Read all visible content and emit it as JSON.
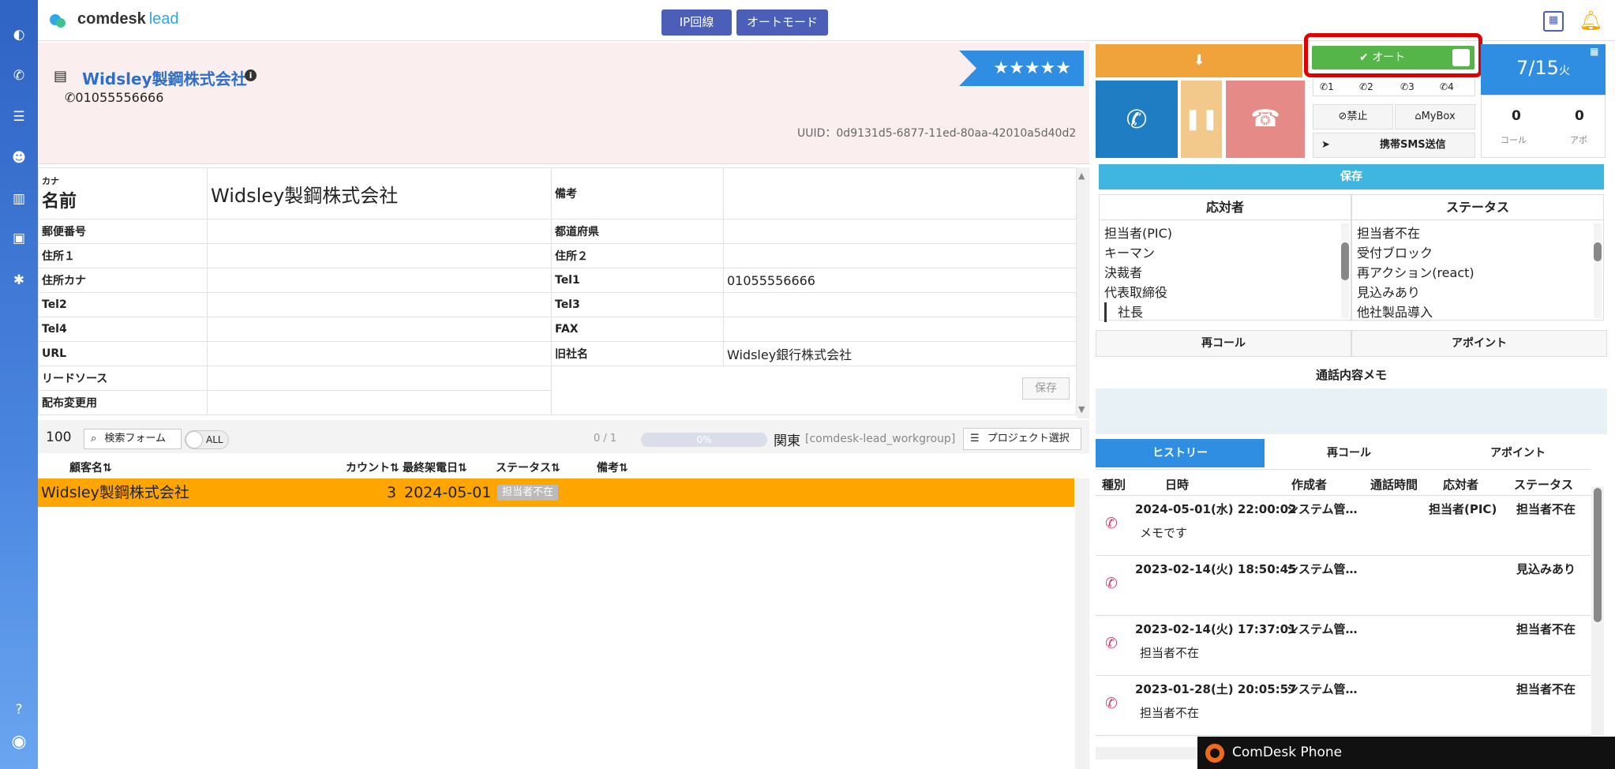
{
  "brand": {
    "name": "comdesk",
    "suffix": "lead"
  },
  "top_buttons": {
    "ip_line": "IP回線",
    "auto_mode": "オートモード"
  },
  "company": {
    "name": "Widsley製鋼株式会社",
    "phone": "01055556666",
    "uuid": "UUID：0d9131d5-6877-11ed-80aa-42010a5d40d2",
    "stars": "★★★★★"
  },
  "fields": {
    "kana_label": "カナ",
    "name_label": "名前",
    "name_value": "Widsley製鋼株式会社",
    "remarks_label": "備考",
    "postal_label": "郵便番号",
    "prefecture_label": "都道府県",
    "address1_label": "住所１",
    "address2_label": "住所２",
    "address_kana_label": "住所カナ",
    "tel1_label": "Tel1",
    "tel1_value": "01055556666",
    "tel2_label": "Tel2",
    "tel3_label": "Tel3",
    "tel4_label": "Tel4",
    "fax_label": "FAX",
    "url_label": "URL",
    "old_name_label": "旧社名",
    "old_name_value": "Widsley銀行株式会社",
    "lead_source_label": "リードソース",
    "distribution_label": "配布変更用",
    "save_label": "保存"
  },
  "list": {
    "page_size": "100",
    "search_form": "検索フォーム",
    "all_label": "ALL",
    "pager": "0 / 1",
    "progress_label": "0%",
    "region": "関東",
    "workgroup": "[comdesk-lead_workgroup]",
    "project_select": "プロジェクト選択",
    "headers": [
      "顧客名⇅",
      "カウント⇅",
      "最終架電日⇅",
      "ステータス⇅",
      "備考⇅"
    ],
    "row": {
      "name": "Widsley製鋼株式会社",
      "count": "3",
      "last_call": "2024-05-01",
      "status": "担当者不在",
      "remarks": ""
    }
  },
  "phone": {
    "auto_label": "オート",
    "lines": [
      "1",
      "2",
      "3",
      "4"
    ],
    "forbid": "禁止",
    "mybox": "MyBox",
    "sms": "携帯SMS送信",
    "date": "7/15",
    "weekday": "火",
    "calls_count": "0",
    "calls_label": "コール",
    "appo_count": "0",
    "appo_label": "アポ",
    "save_label": "保存"
  },
  "responder": {
    "header": "応対者",
    "items": [
      "担当者(PIC)",
      "キーマン",
      "決裁者",
      "代表取締役",
      "社長"
    ]
  },
  "status": {
    "header": "ステータス",
    "items": [
      "担当者不在",
      "受付ブロック",
      "再アクション(react)",
      "見込みあり",
      "他社製品導入"
    ]
  },
  "tabs_mid": {
    "recall": "再コール",
    "appoint": "アポイント"
  },
  "memo": {
    "header": "通話内容メモ"
  },
  "history": {
    "tabs": [
      "ヒストリー",
      "再コール",
      "アポイント"
    ],
    "headers": [
      "種別",
      "日時",
      "作成者",
      "通話時間",
      "応対者",
      "ステータス"
    ],
    "rows": [
      {
        "datetime": "2024-05-01(水) 22:00:02",
        "creator": "システム管…",
        "duration": "",
        "responder": "担当者(PIC)",
        "status": "担当者不在",
        "memo": "メモです"
      },
      {
        "datetime": "2023-02-14(火) 18:50:45",
        "creator": "システム管…",
        "duration": "",
        "responder": "",
        "status": "見込みあり",
        "memo": ""
      },
      {
        "datetime": "2023-02-14(火) 17:37:01",
        "creator": "システム管…",
        "duration": "",
        "responder": "",
        "status": "担当者不在",
        "memo": "担当者不在"
      },
      {
        "datetime": "2023-01-28(土) 20:05:57",
        "creator": "システム管…",
        "duration": "",
        "responder": "",
        "status": "担当者不在",
        "memo": "担当者不在"
      }
    ]
  },
  "comdesk_phone": {
    "label": "ComDesk Phone"
  },
  "colors": {
    "accent": "#2f8ee2",
    "orange": "#ffa500",
    "green": "#55b548",
    "call_blue": "#1f7dc4",
    "hangup": "#e58a86",
    "pause": "#f2c98b",
    "highlight": "#e00000"
  }
}
